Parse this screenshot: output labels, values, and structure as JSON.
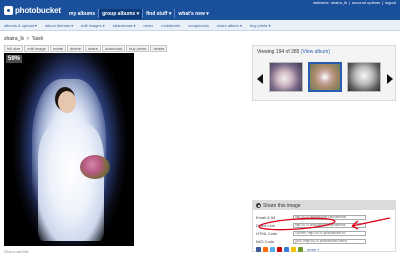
{
  "header": {
    "logo_text": "photobucket",
    "nav": [
      "my albums",
      "group albums",
      "find stuff",
      "what's new"
    ],
    "welcome": "welcome, shaira_lk",
    "account_links": [
      "account options",
      "logout"
    ]
  },
  "subnav": {
    "items": [
      "albums & upload",
      "album themes",
      "edit images",
      "slideshows",
      "remix",
      "mobileweb",
      "scrapbooks",
      "share album",
      "buy prints"
    ]
  },
  "breadcrumb": {
    "user": "shaira_lk",
    "separator": ">",
    "album": "Taish"
  },
  "toolbar": {
    "buttons": [
      "full size",
      "edit image",
      "rotate",
      "delete",
      "share",
      "download",
      "buy prints",
      "delete"
    ]
  },
  "photo": {
    "zoom": "59%",
    "caption": "Click to add title"
  },
  "viewing": {
    "text": "Viewing 194 of 285",
    "link": "(View album)"
  },
  "share": {
    "title": "Share this image",
    "rows": [
      {
        "label": "Email & IM",
        "value": "http://i270.photobucket.com/albums/"
      },
      {
        "label": "Direct Link",
        "value": "http://i270.photobucket.com/albums"
      },
      {
        "label": "HTML Code",
        "value": "<a href=\"http://s270.photobucket.co"
      },
      {
        "label": "IMG Code",
        "value": "[URL=http://s270.photobucket.com/a"
      }
    ],
    "more": "more »"
  },
  "colors": {
    "topbar": "#1a4f9c",
    "link": "#2a5db0",
    "annotation": "#e0001b"
  }
}
